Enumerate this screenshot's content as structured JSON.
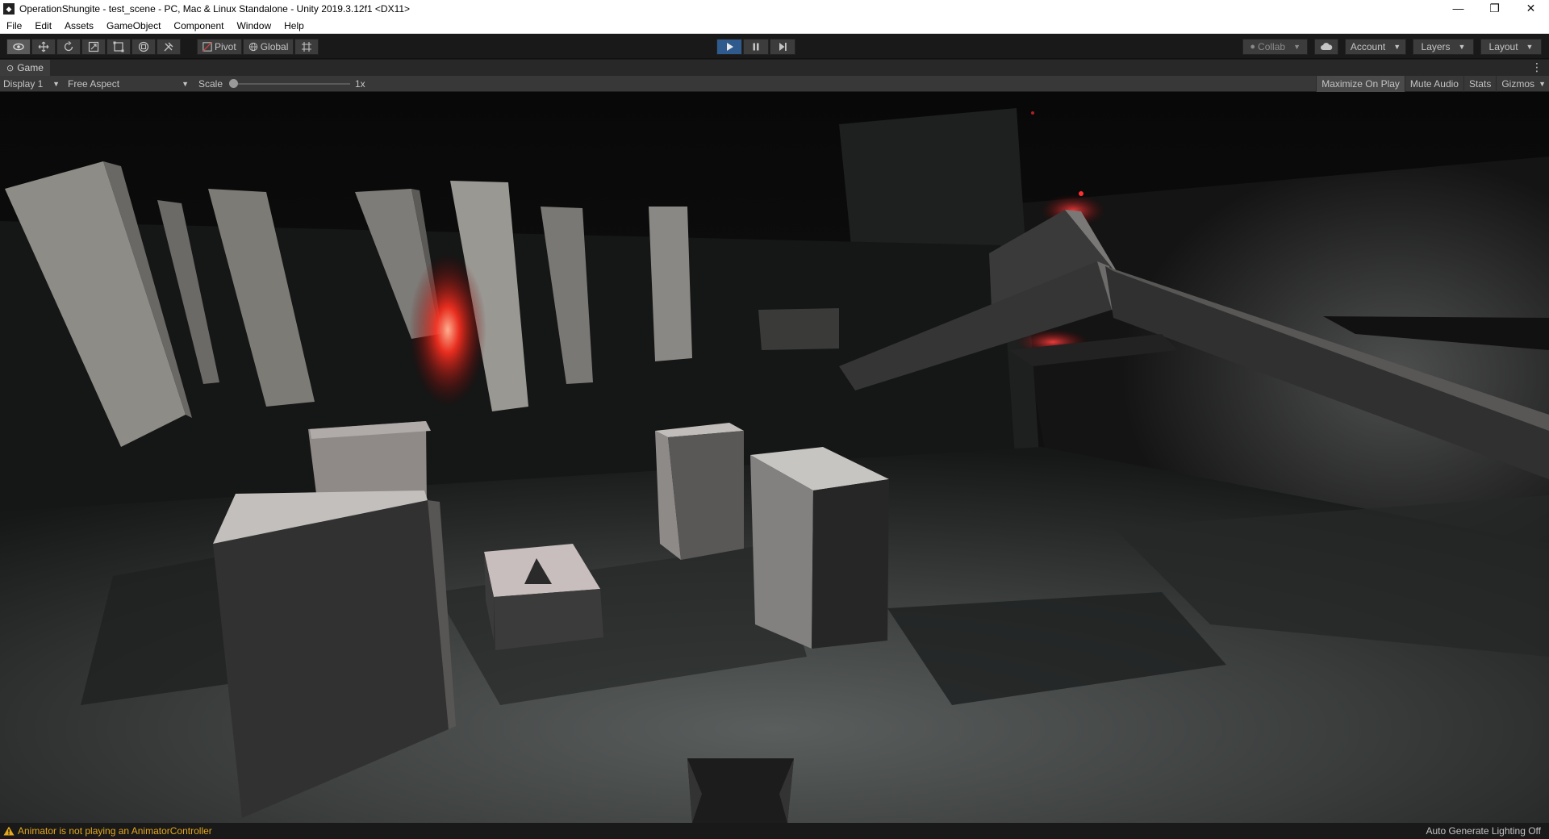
{
  "window": {
    "title": "OperationShungite - test_scene - PC, Mac & Linux Standalone - Unity 2019.3.12f1 <DX11>",
    "icon": "unity-logo-icon"
  },
  "menu": [
    "File",
    "Edit",
    "Assets",
    "GameObject",
    "Component",
    "Window",
    "Help"
  ],
  "toolbar": {
    "tools": [
      "hand-tool-icon",
      "move-tool-icon",
      "rotate-tool-icon",
      "scale-tool-icon",
      "rect-tool-icon",
      "transform-tool-icon",
      "custom-tool-icon"
    ],
    "pivot_label": "Pivot",
    "global_label": "Global",
    "collab_label": "Collab",
    "account_label": "Account",
    "layers_label": "Layers",
    "layout_label": "Layout"
  },
  "game_tab": {
    "label": "Game"
  },
  "game_bar": {
    "display_label": "Display 1",
    "aspect_label": "Free Aspect",
    "scale_label": "Scale",
    "scale_value": "1x",
    "maximize_label": "Maximize On Play",
    "mute_label": "Mute Audio",
    "stats_label": "Stats",
    "gizmos_label": "Gizmos"
  },
  "status": {
    "warning_text": "Animator is not playing an AnimatorController",
    "lighting_text": "Auto Generate Lighting Off",
    "warning_color": "#e6a81d"
  }
}
